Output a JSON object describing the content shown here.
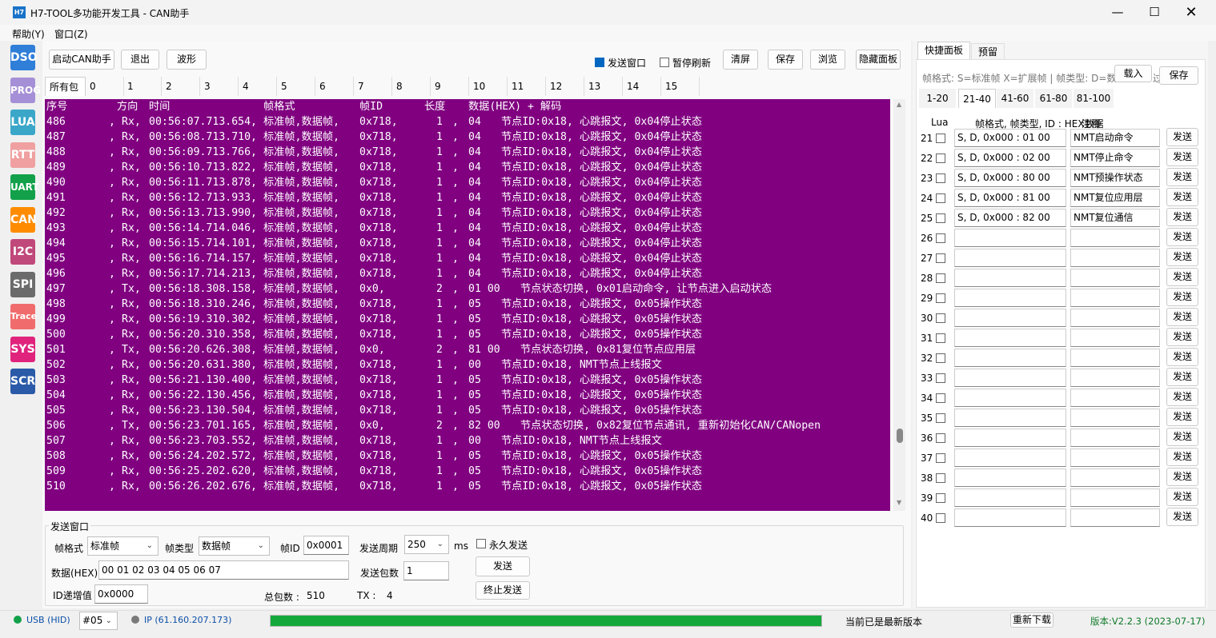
{
  "window": {
    "title": "H7-TOOL多功能开发工具 - CAN助手",
    "icon": "H7"
  },
  "menu": [
    "帮助(Y)",
    "窗口(Z)"
  ],
  "sidebar": [
    {
      "label": "DSO",
      "color": "#2f7ed8"
    },
    {
      "label": "PROG",
      "color": "#a58fd6"
    },
    {
      "label": "LUA",
      "color": "#3aa7c9"
    },
    {
      "label": "RTT",
      "color": "#f0a0a0"
    },
    {
      "label": "UART",
      "color": "#12a14a"
    },
    {
      "label": "CAN",
      "color": "#ff8c00"
    },
    {
      "label": "I2C",
      "color": "#c0487a"
    },
    {
      "label": "SPI",
      "color": "#6b6b6b"
    },
    {
      "label": "Trace",
      "color": "#f06c6c"
    },
    {
      "label": "SYS",
      "color": "#e0237d"
    },
    {
      "label": "SCR",
      "color": "#2a5aa8"
    }
  ],
  "toolbar": {
    "start": "启动CAN助手",
    "exit": "退出",
    "wave": "波形",
    "send_window": "发送窗口",
    "pause": "暂停刷新",
    "clear": "清屏",
    "save": "保存",
    "browse": "浏览",
    "hide_panel": "隐藏面板"
  },
  "filter_tabs": [
    "所有包",
    "0",
    "1",
    "2",
    "3",
    "4",
    "5",
    "6",
    "7",
    "8",
    "9",
    "10",
    "11",
    "12",
    "13",
    "14",
    "15"
  ],
  "log": {
    "header": {
      "seq": "序号",
      "dir": "方向",
      "time": "时间",
      "fmt": "帧格式",
      "id": "帧ID",
      "len": "长度",
      "data": "数据(HEX) + 解码"
    },
    "rows": [
      {
        "seq": "486",
        "dir": "Rx,",
        "time": "00:56:07.713.654,",
        "fmt": "标准帧,数据帧,",
        "id": "0x718,",
        "len": "1",
        "data": "04",
        "decode": "节点ID:0x18, 心跳报文, 0x04停止状态"
      },
      {
        "seq": "487",
        "dir": "Rx,",
        "time": "00:56:08.713.710,",
        "fmt": "标准帧,数据帧,",
        "id": "0x718,",
        "len": "1",
        "data": "04",
        "decode": "节点ID:0x18, 心跳报文, 0x04停止状态"
      },
      {
        "seq": "488",
        "dir": "Rx,",
        "time": "00:56:09.713.766,",
        "fmt": "标准帧,数据帧,",
        "id": "0x718,",
        "len": "1",
        "data": "04",
        "decode": "节点ID:0x18, 心跳报文, 0x04停止状态"
      },
      {
        "seq": "489",
        "dir": "Rx,",
        "time": "00:56:10.713.822,",
        "fmt": "标准帧,数据帧,",
        "id": "0x718,",
        "len": "1",
        "data": "04",
        "decode": "节点ID:0x18, 心跳报文, 0x04停止状态"
      },
      {
        "seq": "490",
        "dir": "Rx,",
        "time": "00:56:11.713.878,",
        "fmt": "标准帧,数据帧,",
        "id": "0x718,",
        "len": "1",
        "data": "04",
        "decode": "节点ID:0x18, 心跳报文, 0x04停止状态"
      },
      {
        "seq": "491",
        "dir": "Rx,",
        "time": "00:56:12.713.933,",
        "fmt": "标准帧,数据帧,",
        "id": "0x718,",
        "len": "1",
        "data": "04",
        "decode": "节点ID:0x18, 心跳报文, 0x04停止状态"
      },
      {
        "seq": "492",
        "dir": "Rx,",
        "time": "00:56:13.713.990,",
        "fmt": "标准帧,数据帧,",
        "id": "0x718,",
        "len": "1",
        "data": "04",
        "decode": "节点ID:0x18, 心跳报文, 0x04停止状态"
      },
      {
        "seq": "493",
        "dir": "Rx,",
        "time": "00:56:14.714.046,",
        "fmt": "标准帧,数据帧,",
        "id": "0x718,",
        "len": "1",
        "data": "04",
        "decode": "节点ID:0x18, 心跳报文, 0x04停止状态"
      },
      {
        "seq": "494",
        "dir": "Rx,",
        "time": "00:56:15.714.101,",
        "fmt": "标准帧,数据帧,",
        "id": "0x718,",
        "len": "1",
        "data": "04",
        "decode": "节点ID:0x18, 心跳报文, 0x04停止状态"
      },
      {
        "seq": "495",
        "dir": "Rx,",
        "time": "00:56:16.714.157,",
        "fmt": "标准帧,数据帧,",
        "id": "0x718,",
        "len": "1",
        "data": "04",
        "decode": "节点ID:0x18, 心跳报文, 0x04停止状态"
      },
      {
        "seq": "496",
        "dir": "Rx,",
        "time": "00:56:17.714.213,",
        "fmt": "标准帧,数据帧,",
        "id": "0x718,",
        "len": "1",
        "data": "04",
        "decode": "节点ID:0x18, 心跳报文, 0x04停止状态"
      },
      {
        "seq": "497",
        "dir": "Tx,",
        "time": "00:56:18.308.158,",
        "fmt": "标准帧,数据帧,",
        "id": "0x0,",
        "len": "2",
        "data": "01 00",
        "decode": "节点状态切换, 0x01启动命令, 让节点进入启动状态"
      },
      {
        "seq": "498",
        "dir": "Rx,",
        "time": "00:56:18.310.246,",
        "fmt": "标准帧,数据帧,",
        "id": "0x718,",
        "len": "1",
        "data": "05",
        "decode": "节点ID:0x18, 心跳报文, 0x05操作状态"
      },
      {
        "seq": "499",
        "dir": "Rx,",
        "time": "00:56:19.310.302,",
        "fmt": "标准帧,数据帧,",
        "id": "0x718,",
        "len": "1",
        "data": "05",
        "decode": "节点ID:0x18, 心跳报文, 0x05操作状态"
      },
      {
        "seq": "500",
        "dir": "Rx,",
        "time": "00:56:20.310.358,",
        "fmt": "标准帧,数据帧,",
        "id": "0x718,",
        "len": "1",
        "data": "05",
        "decode": "节点ID:0x18, 心跳报文, 0x05操作状态"
      },
      {
        "seq": "501",
        "dir": "Tx,",
        "time": "00:56:20.626.308,",
        "fmt": "标准帧,数据帧,",
        "id": "0x0,",
        "len": "2",
        "data": "81 00",
        "decode": "节点状态切换, 0x81复位节点应用层"
      },
      {
        "seq": "502",
        "dir": "Rx,",
        "time": "00:56:20.631.380,",
        "fmt": "标准帧,数据帧,",
        "id": "0x718,",
        "len": "1",
        "data": "00",
        "decode": "节点ID:0x18, NMT节点上线报文"
      },
      {
        "seq": "503",
        "dir": "Rx,",
        "time": "00:56:21.130.400,",
        "fmt": "标准帧,数据帧,",
        "id": "0x718,",
        "len": "1",
        "data": "05",
        "decode": "节点ID:0x18, 心跳报文, 0x05操作状态"
      },
      {
        "seq": "504",
        "dir": "Rx,",
        "time": "00:56:22.130.456,",
        "fmt": "标准帧,数据帧,",
        "id": "0x718,",
        "len": "1",
        "data": "05",
        "decode": "节点ID:0x18, 心跳报文, 0x05操作状态"
      },
      {
        "seq": "505",
        "dir": "Rx,",
        "time": "00:56:23.130.504,",
        "fmt": "标准帧,数据帧,",
        "id": "0x718,",
        "len": "1",
        "data": "05",
        "decode": "节点ID:0x18, 心跳报文, 0x05操作状态"
      },
      {
        "seq": "506",
        "dir": "Tx,",
        "time": "00:56:23.701.165,",
        "fmt": "标准帧,数据帧,",
        "id": "0x0,",
        "len": "2",
        "data": "82 00",
        "decode": "节点状态切换, 0x82复位节点通讯, 重新初始化CAN/CANopen"
      },
      {
        "seq": "507",
        "dir": "Rx,",
        "time": "00:56:23.703.552,",
        "fmt": "标准帧,数据帧,",
        "id": "0x718,",
        "len": "1",
        "data": "00",
        "decode": "节点ID:0x18, NMT节点上线报文"
      },
      {
        "seq": "508",
        "dir": "Rx,",
        "time": "00:56:24.202.572,",
        "fmt": "标准帧,数据帧,",
        "id": "0x718,",
        "len": "1",
        "data": "05",
        "decode": "节点ID:0x18, 心跳报文, 0x05操作状态"
      },
      {
        "seq": "509",
        "dir": "Rx,",
        "time": "00:56:25.202.620,",
        "fmt": "标准帧,数据帧,",
        "id": "0x718,",
        "len": "1",
        "data": "05",
        "decode": "节点ID:0x18, 心跳报文, 0x05操作状态"
      },
      {
        "seq": "510",
        "dir": "Rx,",
        "time": "00:56:26.202.676,",
        "fmt": "标准帧,数据帧,",
        "id": "0x718,",
        "len": "1",
        "data": "05",
        "decode": "节点ID:0x18, 心跳报文, 0x05操作状态"
      }
    ]
  },
  "send_group": {
    "title": "发送窗口",
    "frame_format_label": "帧格式",
    "frame_format": "标准帧",
    "frame_type_label": "帧类型",
    "frame_type": "数据帧",
    "frame_id_label": "帧ID",
    "frame_id": "0x0001",
    "period_label": "发送周期",
    "period": "250",
    "period_unit": "ms",
    "forever": "永久发送",
    "data_label": "数据(HEX)",
    "data": "00 01 02 03 04 05 06 07",
    "count_label": "发送包数",
    "count": "1",
    "send": "发送",
    "stop": "终止发送",
    "id_inc_label": "ID递增值",
    "id_inc": "0x0000",
    "total_label": "总包数 :",
    "total": "510",
    "tx_label": "TX :",
    "tx": "4"
  },
  "panel": {
    "tabs": [
      "快捷面板",
      "预留"
    ],
    "hint": "帧格式: S=标准帧 X=扩展帧 | 帧类型: D=数",
    "hint_tail": "过",
    "load": "载入",
    "save": "保存",
    "page_tabs": [
      "1-20",
      "21-40",
      "41-60",
      "61-80",
      "81-100"
    ],
    "col_lua": "Lua",
    "col_fields": "帧格式, 帧类型, ID : HEX数据",
    "col_note": "注释",
    "send_label": "发送",
    "rows": [
      {
        "n": "21",
        "f1": "S, D, 0x000 : 01 00",
        "f2": "NMT启动命令"
      },
      {
        "n": "22",
        "f1": "S, D, 0x000 : 02 00",
        "f2": "NMT停止命令"
      },
      {
        "n": "23",
        "f1": "S, D, 0x000 : 80 00",
        "f2": "NMT预操作状态"
      },
      {
        "n": "24",
        "f1": "S, D, 0x000 : 81 00",
        "f2": "NMT复位应用层"
      },
      {
        "n": "25",
        "f1": "S, D, 0x000 : 82 00",
        "f2": "NMT复位通信"
      },
      {
        "n": "26",
        "f1": "",
        "f2": ""
      },
      {
        "n": "27",
        "f1": "",
        "f2": ""
      },
      {
        "n": "28",
        "f1": "",
        "f2": ""
      },
      {
        "n": "29",
        "f1": "",
        "f2": ""
      },
      {
        "n": "30",
        "f1": "",
        "f2": ""
      },
      {
        "n": "31",
        "f1": "",
        "f2": ""
      },
      {
        "n": "32",
        "f1": "",
        "f2": ""
      },
      {
        "n": "33",
        "f1": "",
        "f2": ""
      },
      {
        "n": "34",
        "f1": "",
        "f2": ""
      },
      {
        "n": "35",
        "f1": "",
        "f2": ""
      },
      {
        "n": "36",
        "f1": "",
        "f2": ""
      },
      {
        "n": "37",
        "f1": "",
        "f2": ""
      },
      {
        "n": "38",
        "f1": "",
        "f2": ""
      },
      {
        "n": "39",
        "f1": "",
        "f2": ""
      },
      {
        "n": "40",
        "f1": "",
        "f2": ""
      }
    ]
  },
  "status": {
    "usb": "USB (HID)",
    "device": "#05",
    "ip": "IP (61.160.207.173)",
    "progress": 1.0,
    "update_msg": "当前已是最新版本",
    "redownload": "重新下载",
    "version": "版本:V2.2.3 (2023-07-17)",
    "usb_color": "#12a14a",
    "ip_color": "#7a7a7a",
    "progress_color": "#14a83c",
    "version_color": "#0f7a2a"
  }
}
